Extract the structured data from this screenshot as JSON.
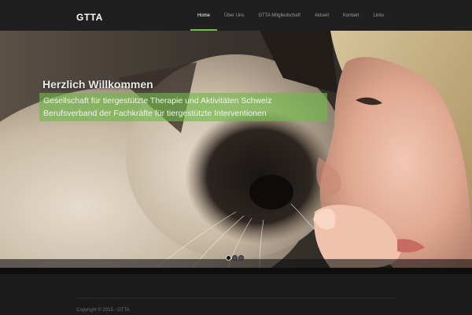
{
  "site": {
    "logo": "GTTA"
  },
  "nav": {
    "items": [
      {
        "label": "Home",
        "active": true
      },
      {
        "label": "Über Uns",
        "active": false
      },
      {
        "label": "GTTA Mitgliedschaft",
        "active": false
      },
      {
        "label": "Aktuell",
        "active": false
      },
      {
        "label": "Kontakt",
        "active": false
      },
      {
        "label": "Links",
        "active": false
      }
    ]
  },
  "hero": {
    "title": "Herzlich Willkommen",
    "subtitle_line1": "Gesellschaft für tiergestützte Therapie und Aktivitäten Schweiz",
    "subtitle_line2": "Berufsverband der Fachkräfte für tiergestützte Interventionen",
    "slide_count": 3,
    "active_slide": 1,
    "accent_color": "#6cbf4a"
  },
  "footer": {
    "copyright": "Copyright © 2015 - GTTA"
  }
}
